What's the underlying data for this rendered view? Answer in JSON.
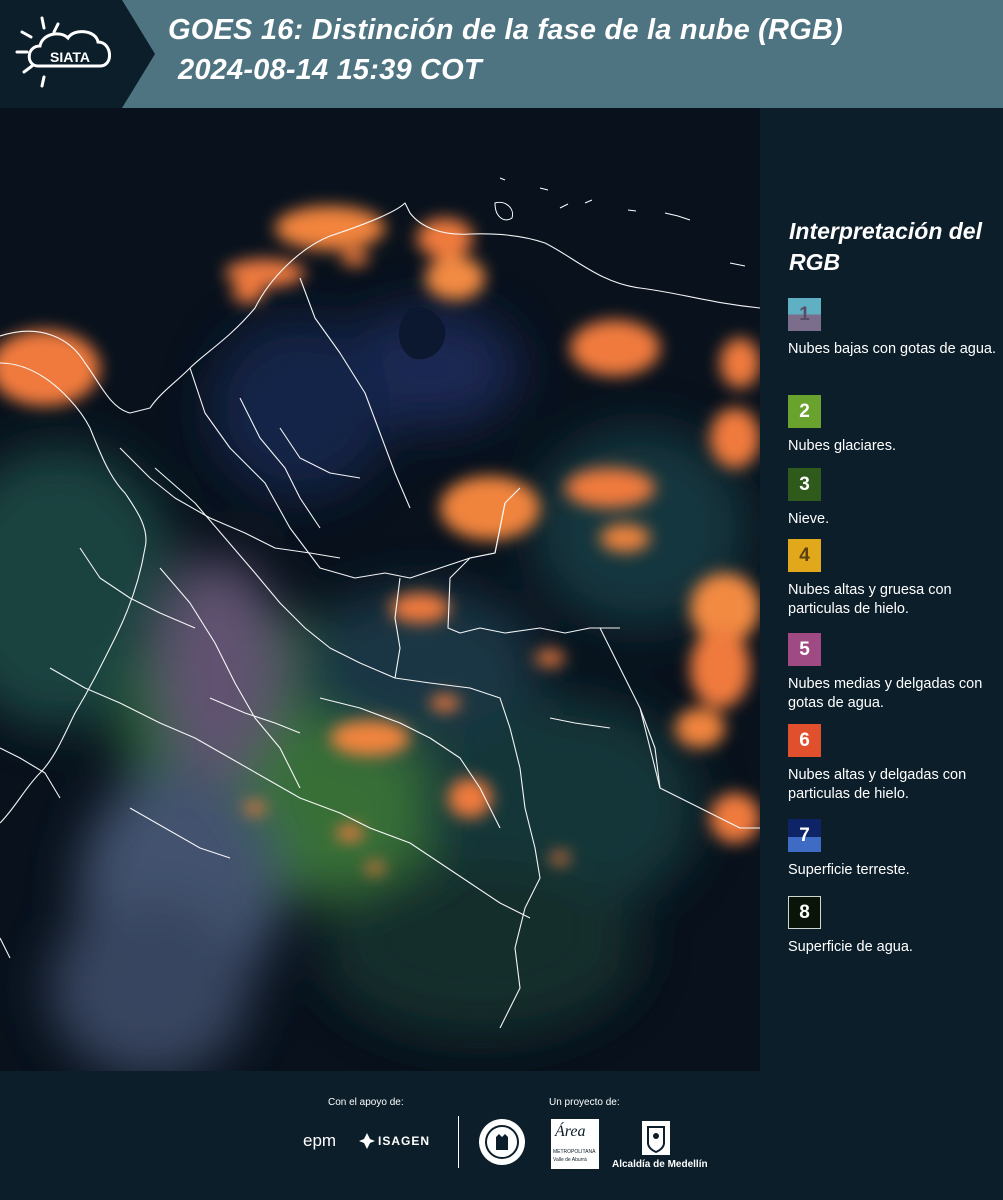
{
  "header": {
    "logo_text": "SIATA",
    "title": "GOES 16: Distinción de la fase de la nube (RGB)",
    "subtitle": "2024-08-14 15:39 COT"
  },
  "map": {
    "icon": "satellite-rgb-map",
    "colors": {
      "background": "#08111c",
      "ice_cloud": "#f07a3c",
      "land": "#1e4a4a",
      "border": "#ffffff"
    }
  },
  "legend": {
    "title": "Interpretación del RGB",
    "items": [
      {
        "number": "1",
        "label": "Nubes bajas con gotas de agua.",
        "color_top": "#5fb0c2",
        "color_bottom": "#7a6e8c"
      },
      {
        "number": "2",
        "label": "Nubes glaciares.",
        "color_top": "#6aa22e",
        "color_bottom": "#6aa22e"
      },
      {
        "number": "3",
        "label": "Nieve.",
        "color_top": "#2e5a1c",
        "color_bottom": "#2e5a1c"
      },
      {
        "number": "4",
        "label": "Nubes altas y gruesa con particulas de hielo.",
        "color_top": "#e0a81a",
        "color_bottom": "#e0a81a"
      },
      {
        "number": "5",
        "label": "Nubes medias y delgadas con gotas de agua.",
        "color_top": "#a04a84",
        "color_bottom": "#a04a84"
      },
      {
        "number": "6",
        "label": "Nubes altas y delgadas con particulas de hielo.",
        "color_top": "#e0502c",
        "color_bottom": "#e0502c"
      },
      {
        "number": "7",
        "label": "Superficie terreste.",
        "color_top": "#0e2466",
        "color_bottom": "#3e6cc4"
      },
      {
        "number": "8",
        "label": "Superficie de agua.",
        "color_top": "#0a1408",
        "color_bottom": "#0a1408"
      }
    ]
  },
  "footer": {
    "support_label": "Con el apoyo de:",
    "project_label": "Un proyecto de:",
    "sponsors": {
      "epm": "epm",
      "isagen": "ISAGEN",
      "area_metropolitana": "Área",
      "area_sub1": "METROPOLITANA",
      "area_sub2": "Valle de Aburrá",
      "alcaldia": "Alcaldía de Medellín"
    }
  }
}
